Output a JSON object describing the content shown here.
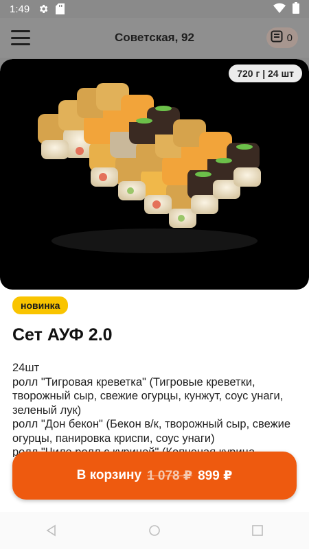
{
  "status_bar": {
    "time": "1:49",
    "icons": [
      "gear-icon",
      "sd-card-icon",
      "wifi-icon",
      "battery-icon"
    ]
  },
  "header": {
    "address": "Советская,  92",
    "cart_count": "0",
    "icons": [
      "menu-icon",
      "cart-icon"
    ]
  },
  "product": {
    "weight_count": "720 г | 24 шт",
    "badge": "новинка",
    "title": "Сет АУФ 2.0",
    "description": "24шт\nролл \"Тигровая креветка\" (Тигровые креветки, творожный сыр, свежие огурцы, кунжут, соус унаги, зеленый лук)\nролл \"Дон бекон\" (Бекон в/к, творожный сыр, свежие огурцы, панировка криспи, соус унаги)\nролл \"Чиле ролл с курицей\" (Копченая курица"
  },
  "cart_button": {
    "label": "В корзину",
    "old_price": "1 078 ₽",
    "price": "899 ₽"
  },
  "colors": {
    "accent": "#ee5a0f",
    "badge": "#f9c400",
    "overlay": "#8a8a8a"
  },
  "nav": {
    "icons": [
      "back-icon",
      "home-icon",
      "recents-icon"
    ]
  }
}
